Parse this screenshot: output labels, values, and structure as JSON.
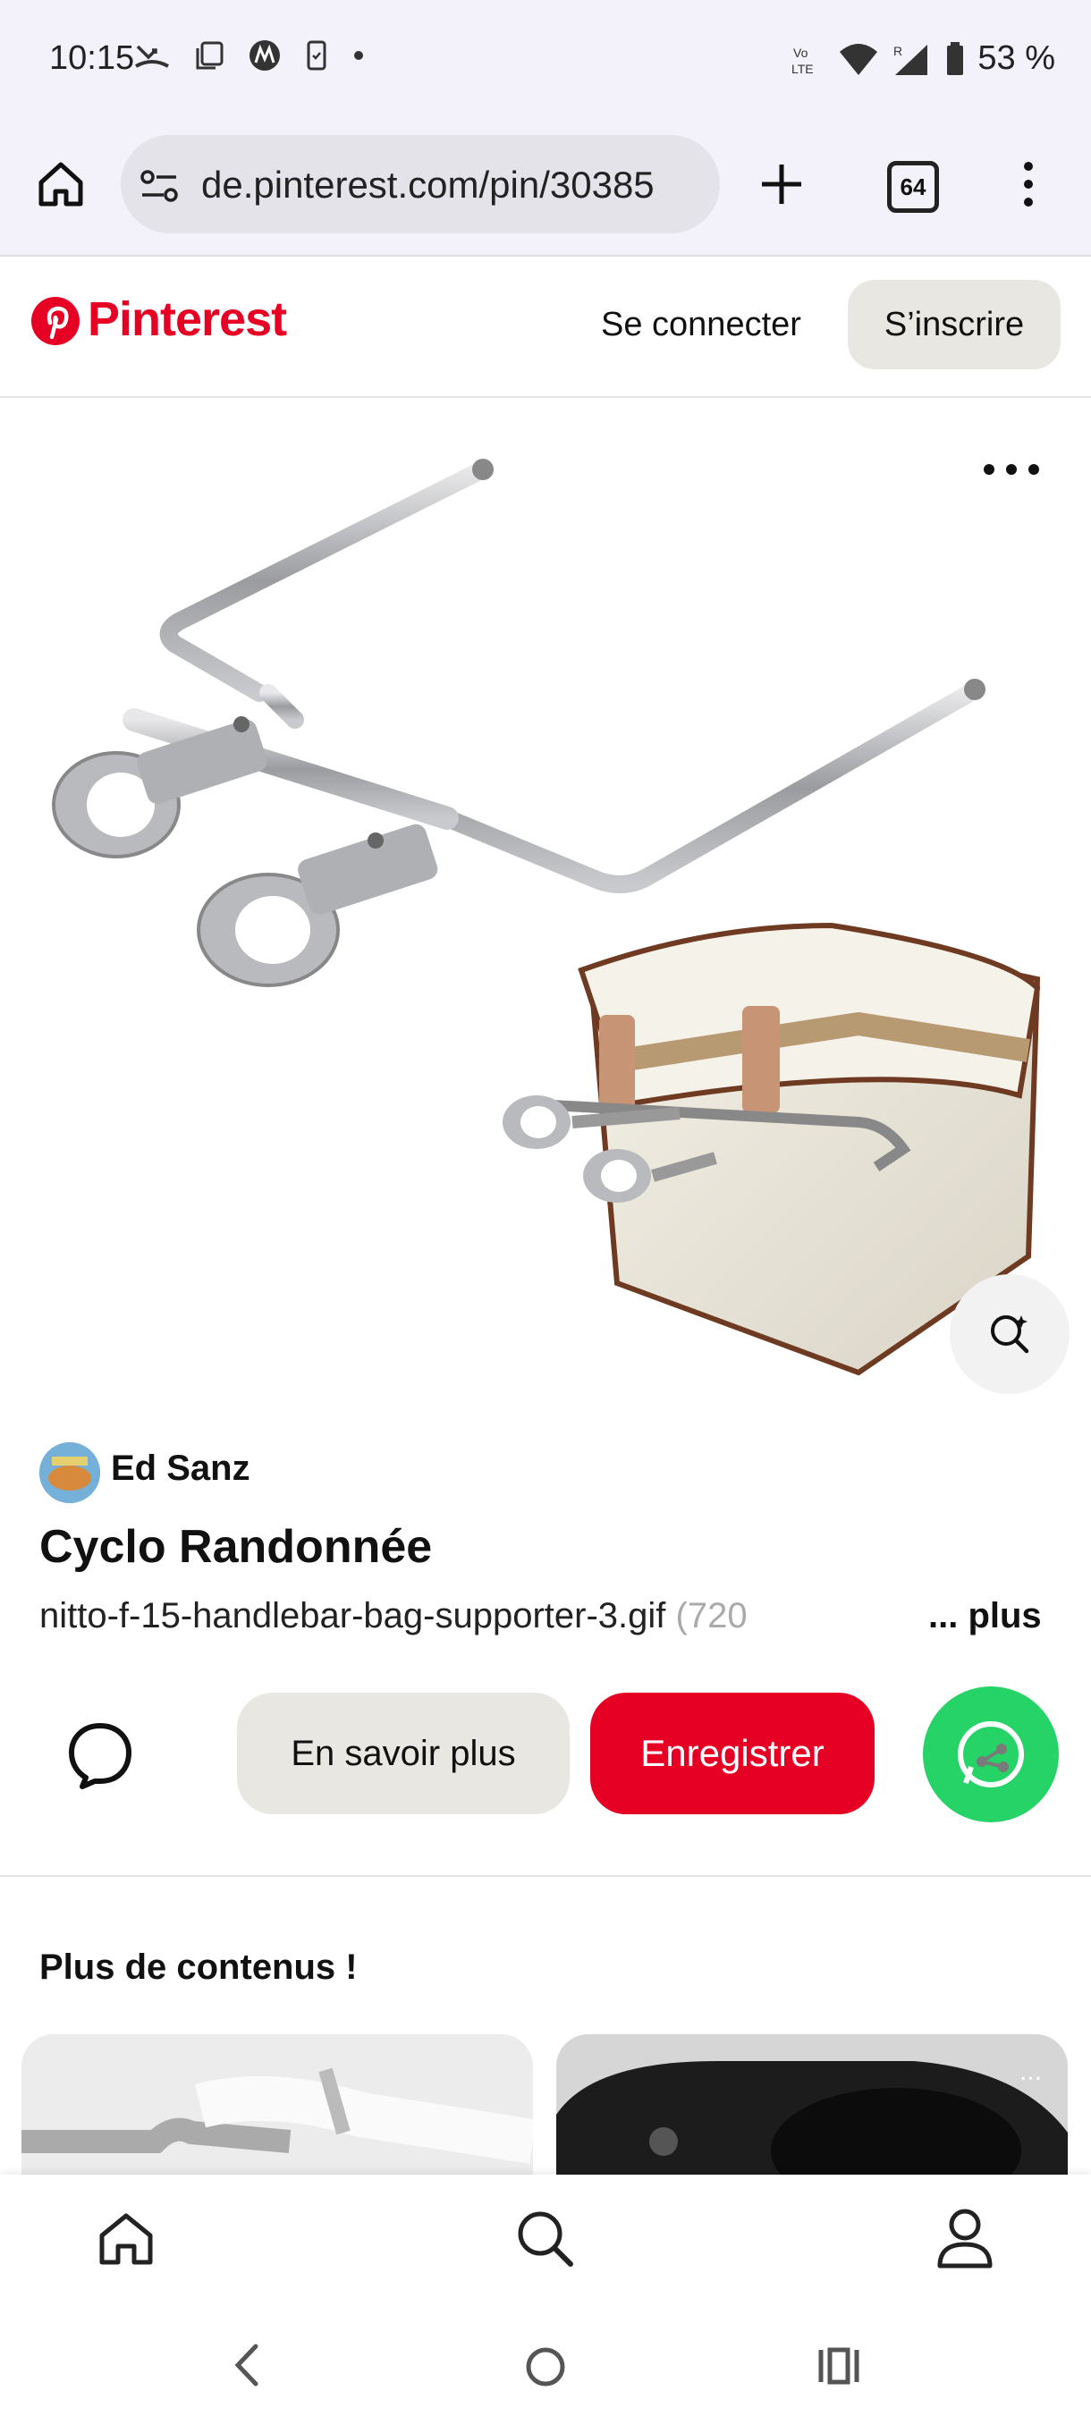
{
  "status_bar": {
    "time": "10:15",
    "battery": "53 %",
    "network": "LTE"
  },
  "browser": {
    "url": "de.pinterest.com/pin/30385",
    "tab_count": "64"
  },
  "header": {
    "logo": "Pinterest",
    "login_label": "Se connecter",
    "signup_label": "S’inscrire",
    "brand_color": "#e60023"
  },
  "pin": {
    "author": "Ed Sanz",
    "title": "Cyclo Randonnée",
    "description": "nitto-f-15-handlebar-bag-supporter-3.gif",
    "description_fade": " (720",
    "more_label": "... plus",
    "learn_more_label": "En savoir plus",
    "save_label": "Enregistrer"
  },
  "more_content": {
    "heading": "Plus de contenus !",
    "card_menu": "..."
  },
  "bottom_nav": {
    "items": [
      "home-icon",
      "search-icon",
      "profile-icon"
    ]
  },
  "system_nav": {
    "items": [
      "back-icon",
      "home-circle-icon",
      "recents-icon"
    ]
  }
}
